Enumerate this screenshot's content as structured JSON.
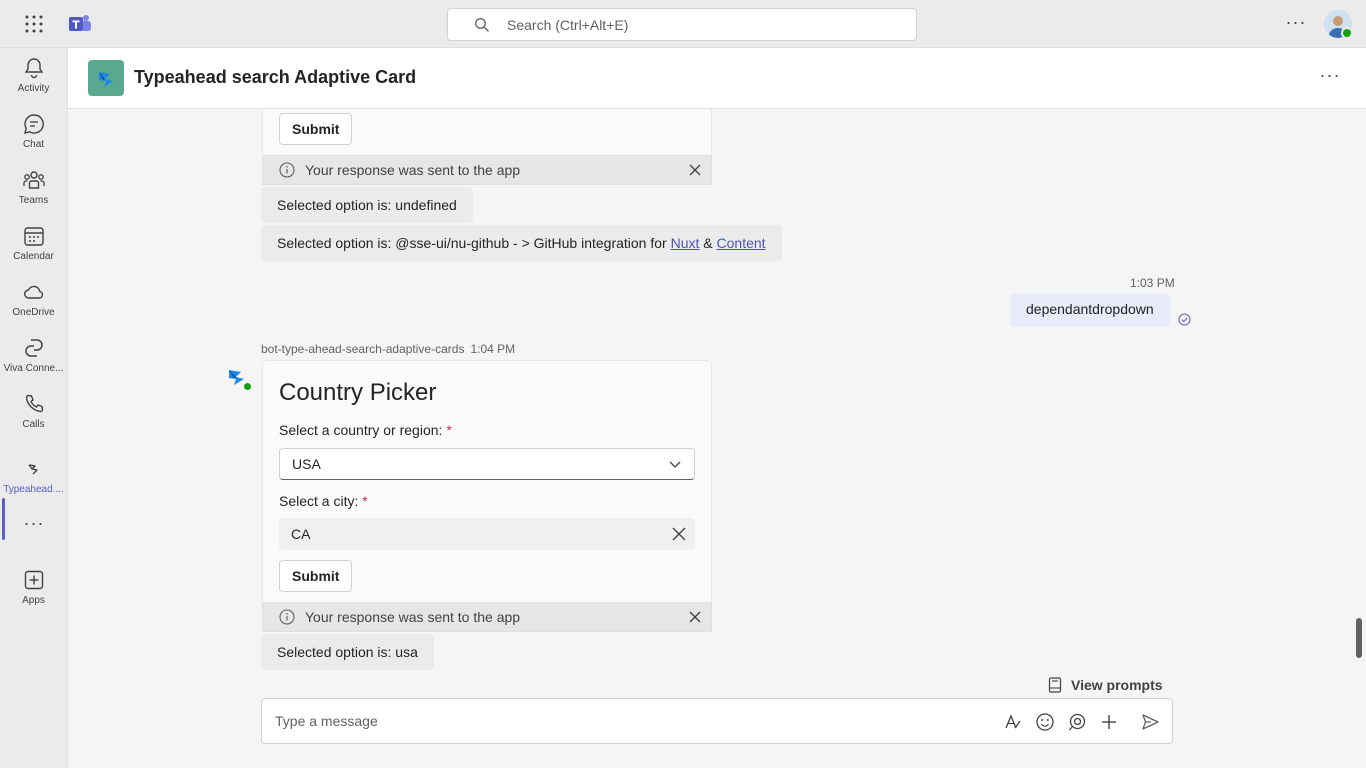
{
  "topbar": {
    "search_placeholder": "Search (Ctrl+Alt+E)",
    "more_label": "···"
  },
  "rail": {
    "items": [
      {
        "label": "Activity",
        "icon": "bell-icon"
      },
      {
        "label": "Chat",
        "icon": "chat-icon"
      },
      {
        "label": "Teams",
        "icon": "teams-icon"
      },
      {
        "label": "Calendar",
        "icon": "calendar-icon"
      },
      {
        "label": "OneDrive",
        "icon": "cloud-icon"
      },
      {
        "label": "Viva Conne...",
        "icon": "viva-connections-icon"
      },
      {
        "label": "Calls",
        "icon": "phone-icon"
      },
      {
        "label": "Typeahead ...",
        "icon": "typeahead-app-icon"
      },
      {
        "label": "Apps",
        "icon": "add-apps-icon"
      }
    ],
    "more_label": "···"
  },
  "header": {
    "title": "Typeahead search Adaptive Card",
    "more_label": "···"
  },
  "messages": {
    "card1_submit": "Submit",
    "notice1_text": "Your response was sent to the app",
    "reply1": "Selected option is: undefined",
    "reply2_prefix": "Selected option is: @sse-ui/nu-github - > GitHub integration for ",
    "reply2_link1": "Nuxt",
    "reply2_amp": " & ",
    "reply2_link2": "Content",
    "my_time": "1:03 PM",
    "my_message": "dependantdropdown",
    "bot_name": "bot-type-ahead-search-adaptive-cards",
    "bot_time": "1:04 PM",
    "card2": {
      "title": "Country Picker",
      "country_label": "Select a country or region: ",
      "country_required": "*",
      "country_value": "USA",
      "city_label": "Select a city: ",
      "city_required": "*",
      "city_value": "CA",
      "submit": "Submit"
    },
    "notice2_text": "Your response was sent to the app",
    "reply3": "Selected option is: usa"
  },
  "composer": {
    "view_prompts": "View prompts",
    "placeholder": "Type a message"
  },
  "colors": {
    "accent": "#5b5fc7",
    "presence_available": "#13a10e",
    "required": "#c4314b",
    "link": "#4f52b2"
  }
}
